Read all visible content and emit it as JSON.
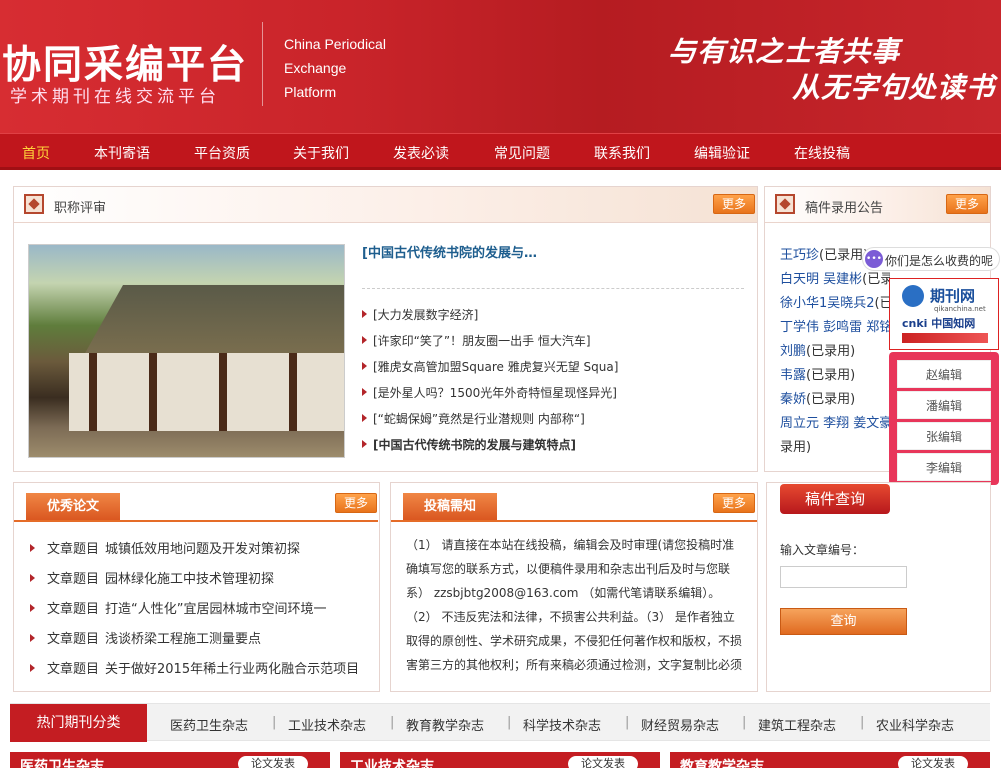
{
  "header": {
    "logo_cn": "协同采编平台",
    "logo_sub": "学术期刊在线交流平台",
    "logo_en_1": "China Periodical",
    "logo_en_2": "Exchange",
    "logo_en_3": "Platform",
    "slogan_1": "与有识之士者共事",
    "slogan_2": "从无字句处读书"
  },
  "nav": [
    "首页",
    "本刊寄语",
    "平台资质",
    "关于我们",
    "发表必读",
    "常见问题",
    "联系我们",
    "编辑验证",
    "在线投稿"
  ],
  "zhicheng": {
    "title": "职称评审",
    "more": "更多",
    "headline": "[中国古代传统书院的发展与…",
    "news": [
      "[大力发展数字经济]",
      "[许家印“笑了”！朋友圈一出手 恒大汽车]",
      "[雅虎女高管加盟Square 雅虎复兴无望 Squa]",
      "[是外星人吗？1500光年外奇特恒星现怪异光]",
      "[“蛇蝎保姆”竟然是行业潜规则 内部称“]",
      "[中国古代传统书院的发展与建筑特点]"
    ]
  },
  "gonggao": {
    "title": "稿件录用公告",
    "more": "更多",
    "lines": [
      {
        "names": "王巧珍",
        "status": "(已录用)"
      },
      {
        "names": "白天明 吴建彬",
        "status": "(已录用)"
      },
      {
        "names": "徐小华1吴晓兵2",
        "status": "(已录用)"
      },
      {
        "names": "丁学伟 彭鸣雷 郑铭",
        "status": ""
      },
      {
        "names": "刘鹏",
        "status": "(已录用)"
      },
      {
        "names": "韦露",
        "status": "(已录用)"
      },
      {
        "names": "秦娇",
        "status": "(已录用)"
      },
      {
        "names": "周立元 李翔 姜文豪",
        "status": ""
      },
      {
        "names": "",
        "status": "录用)"
      }
    ]
  },
  "float": {
    "chat": "你们是怎么收费的呢",
    "logo_1": "期刊网",
    "logo_1_sub": "qikanchina.net",
    "logo_2": "cnki 中国知网",
    "editors": [
      "赵编辑",
      "潘编辑",
      "张编辑",
      "李编辑"
    ]
  },
  "youxiu": {
    "title": "优秀论文",
    "more": "更多",
    "papers": [
      {
        "label": "文章题目",
        "title": "城镇低效用地问题及开发对策初探"
      },
      {
        "label": "文章题目",
        "title": "园林绿化施工中技术管理初探"
      },
      {
        "label": "文章题目",
        "title": "打造“人性化”宜居园林城市空间环境一"
      },
      {
        "label": "文章题目",
        "title": "浅谈桥梁工程施工测量要点"
      },
      {
        "label": "文章题目",
        "title": "关于做好2015年稀土行业两化融合示范项目"
      }
    ]
  },
  "tougao": {
    "title": "投稿需知",
    "more": "更多",
    "text": "（1） 请直接在本站在线投稿，编辑会及时审理(请您投稿时准确填写您的联系方式，以便稿件录用和杂志出刊后及时与您联系） zzsbjbtg2008@163.com （如需代笔请联系编辑）。（2） 不违反宪法和法律，不损害公共利益。（3） 是作者独立取得的原创性、学术研究成果，不侵犯任何著作权和版权，不损害第三方的其他权利；所有来稿必须通过检测，文字复制比必须低于"
  },
  "query": {
    "title": "稿件查询",
    "label": "输入文章编号：",
    "button": "查询"
  },
  "categories": {
    "head": "热门期刊分类",
    "items": [
      "医药卫生杂志",
      "工业技术杂志",
      "教育教学杂志",
      "科学技术杂志",
      "财经贸易杂志",
      "建筑工程杂志",
      "农业科学杂志"
    ]
  },
  "bottom": [
    {
      "title": "医药卫生杂志",
      "pill": "论文发表"
    },
    {
      "title": "工业技术杂志",
      "pill": "论文发表"
    },
    {
      "title": "教育教学杂志",
      "pill": "论文发表"
    }
  ]
}
